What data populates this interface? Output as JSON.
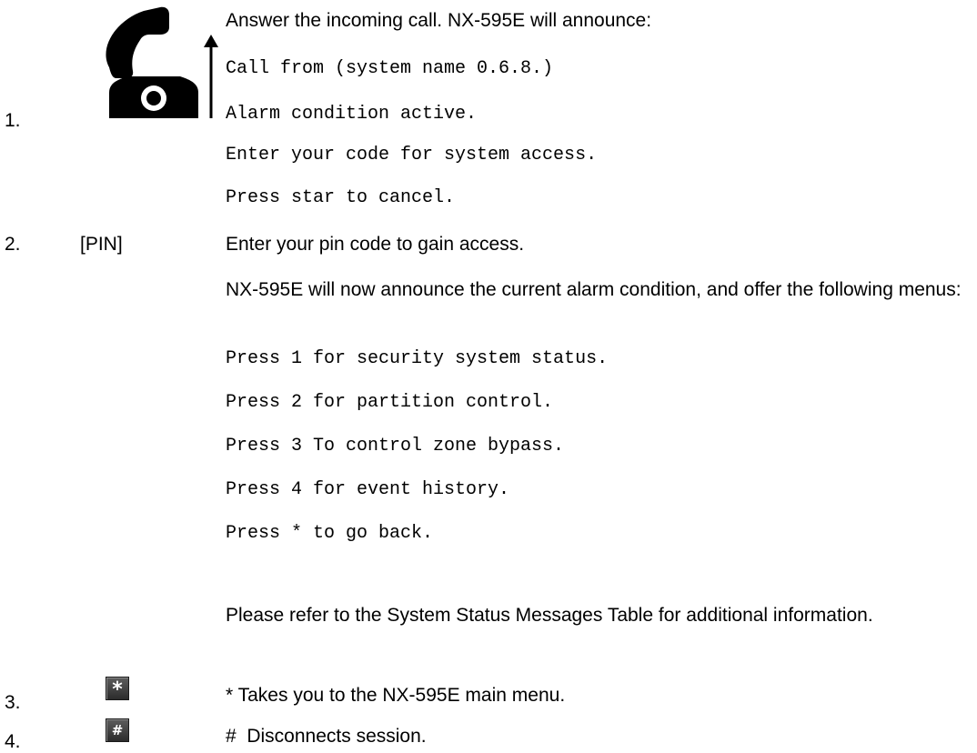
{
  "steps": [
    {
      "number": "1.",
      "icon": "phone-answer-icon",
      "text": "Answer the incoming call. NX-595E will announce:",
      "announcements": [
        "Call from (system name 0.6.8.)",
        "Alarm condition active.",
        "Enter your code for system access.",
        "Press star to cancel."
      ]
    },
    {
      "number": "2.",
      "key": "[PIN]",
      "text": "Enter your pin code to gain access.",
      "description": "NX-595E will now announce the current alarm condition, and offer the following menus:",
      "menu": [
        "Press 1 for security system status.",
        "Press 2 for partition control.",
        "Press 3 To control zone bypass.",
        "Press 4 for event history.",
        "Press * to go back."
      ],
      "note": "Please refer to the System Status Messages Table for additional information."
    },
    {
      "number": "3.",
      "key_symbol": "*",
      "text": "* Takes you to the NX-595E main menu."
    },
    {
      "number": "4.",
      "key_symbol": "#",
      "text": "#  Disconnects session."
    }
  ],
  "colors": {
    "text": "#000000",
    "key_button": "#3a3a3a",
    "key_text": "#ffffff"
  }
}
